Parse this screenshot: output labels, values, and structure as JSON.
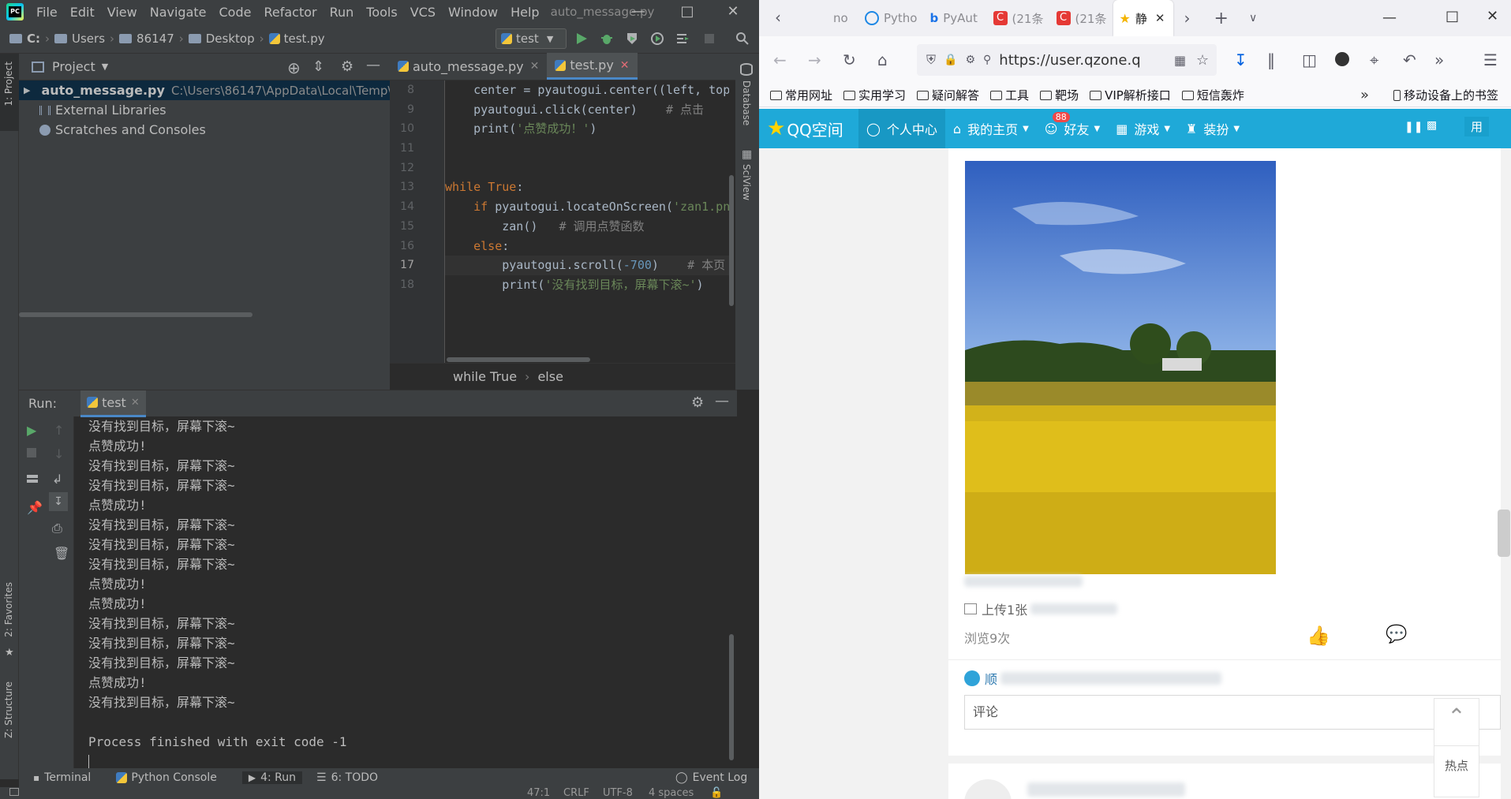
{
  "ide": {
    "menu": [
      "File",
      "Edit",
      "View",
      "Navigate",
      "Code",
      "Refactor",
      "Run",
      "Tools",
      "VCS",
      "Window",
      "Help"
    ],
    "window_title": "auto_message.py",
    "breadcrumbs": [
      "C:",
      "Users",
      "86147",
      "Desktop",
      "test.py"
    ],
    "run_config": "test",
    "project_panel": {
      "title": "Project",
      "items": [
        {
          "label": "auto_message.py",
          "path": "C:\\Users\\86147\\AppData\\Local\\Temp\\"
        },
        {
          "label": "External Libraries"
        },
        {
          "label": "Scratches and Consoles"
        }
      ]
    },
    "left_tabs": {
      "project": "1: Project",
      "favorites": "2: Favorites",
      "structure": "Z: Structure"
    },
    "right_tabs": {
      "database": "Database",
      "sciview": "SciView"
    },
    "editor": {
      "tabs": [
        {
          "label": "auto_message.py",
          "active": false
        },
        {
          "label": "test.py",
          "active": true
        }
      ],
      "line_numbers": [
        "8",
        "9",
        "10",
        "11",
        "12",
        "13",
        "14",
        "15",
        "16",
        "17",
        "18"
      ],
      "code_lines": [
        "    center = pyautogui.center((left, top",
        "    pyautogui.click(center)    # 点击",
        "    print('点赞成功！')",
        "",
        "",
        "while True:",
        "    if pyautogui.locateOnScreen('zan1.pn",
        "        zan()   # 调用点赞函数",
        "    else:",
        "        pyautogui.scroll(-700)    # 本页",
        "        print('没有找到目标，屏幕下滚~') "
      ],
      "crumbs": [
        "while True",
        "else"
      ]
    },
    "run_panel": {
      "label": "Run:",
      "tab": "test",
      "console_lines": [
        "没有找到目标，屏幕下滚~",
        "点赞成功!",
        "没有找到目标，屏幕下滚~",
        "没有找到目标，屏幕下滚~",
        "点赞成功!",
        "没有找到目标，屏幕下滚~",
        "没有找到目标，屏幕下滚~",
        "没有找到目标，屏幕下滚~",
        "点赞成功!",
        "点赞成功!",
        "没有找到目标，屏幕下滚~",
        "没有找到目标，屏幕下滚~",
        "没有找到目标，屏幕下滚~",
        "点赞成功!",
        "没有找到目标，屏幕下滚~",
        "",
        "Process finished with exit code -1"
      ]
    },
    "bottom_tabs": [
      "Terminal",
      "Python Console",
      "4: Run",
      "6: TODO"
    ],
    "event_log": "Event Log",
    "status": {
      "position": "47:1",
      "line_sep": "CRLF",
      "encoding": "UTF-8",
      "indent": "4 spaces"
    }
  },
  "browser": {
    "tabs": [
      {
        "label": "no",
        "active": false
      },
      {
        "label": "Pytho",
        "active": false
      },
      {
        "label": "PyAut",
        "active": false
      },
      {
        "label": "(21条",
        "active": false
      },
      {
        "label": "(21条",
        "active": false
      },
      {
        "label": "静",
        "active": true
      }
    ],
    "url": "https://user.qzone.q",
    "bookmarks": [
      "常用网址",
      "实用学习",
      "疑问解答",
      "工具",
      "靶场",
      "VIP解析接口",
      "短信轰炸"
    ],
    "mobile_bookmarks": "移动设备上的书签",
    "qzone": {
      "logo": "QQ空间",
      "nav": [
        "个人中心",
        "我的主页",
        "好友",
        "游戏",
        "装扮"
      ],
      "friend_badge": "88",
      "right_text": "用",
      "upload_text": "上传1张",
      "views": "浏览9次",
      "liker_text": "顺",
      "comment_placeholder": "评论",
      "hot_label": "热点"
    }
  }
}
